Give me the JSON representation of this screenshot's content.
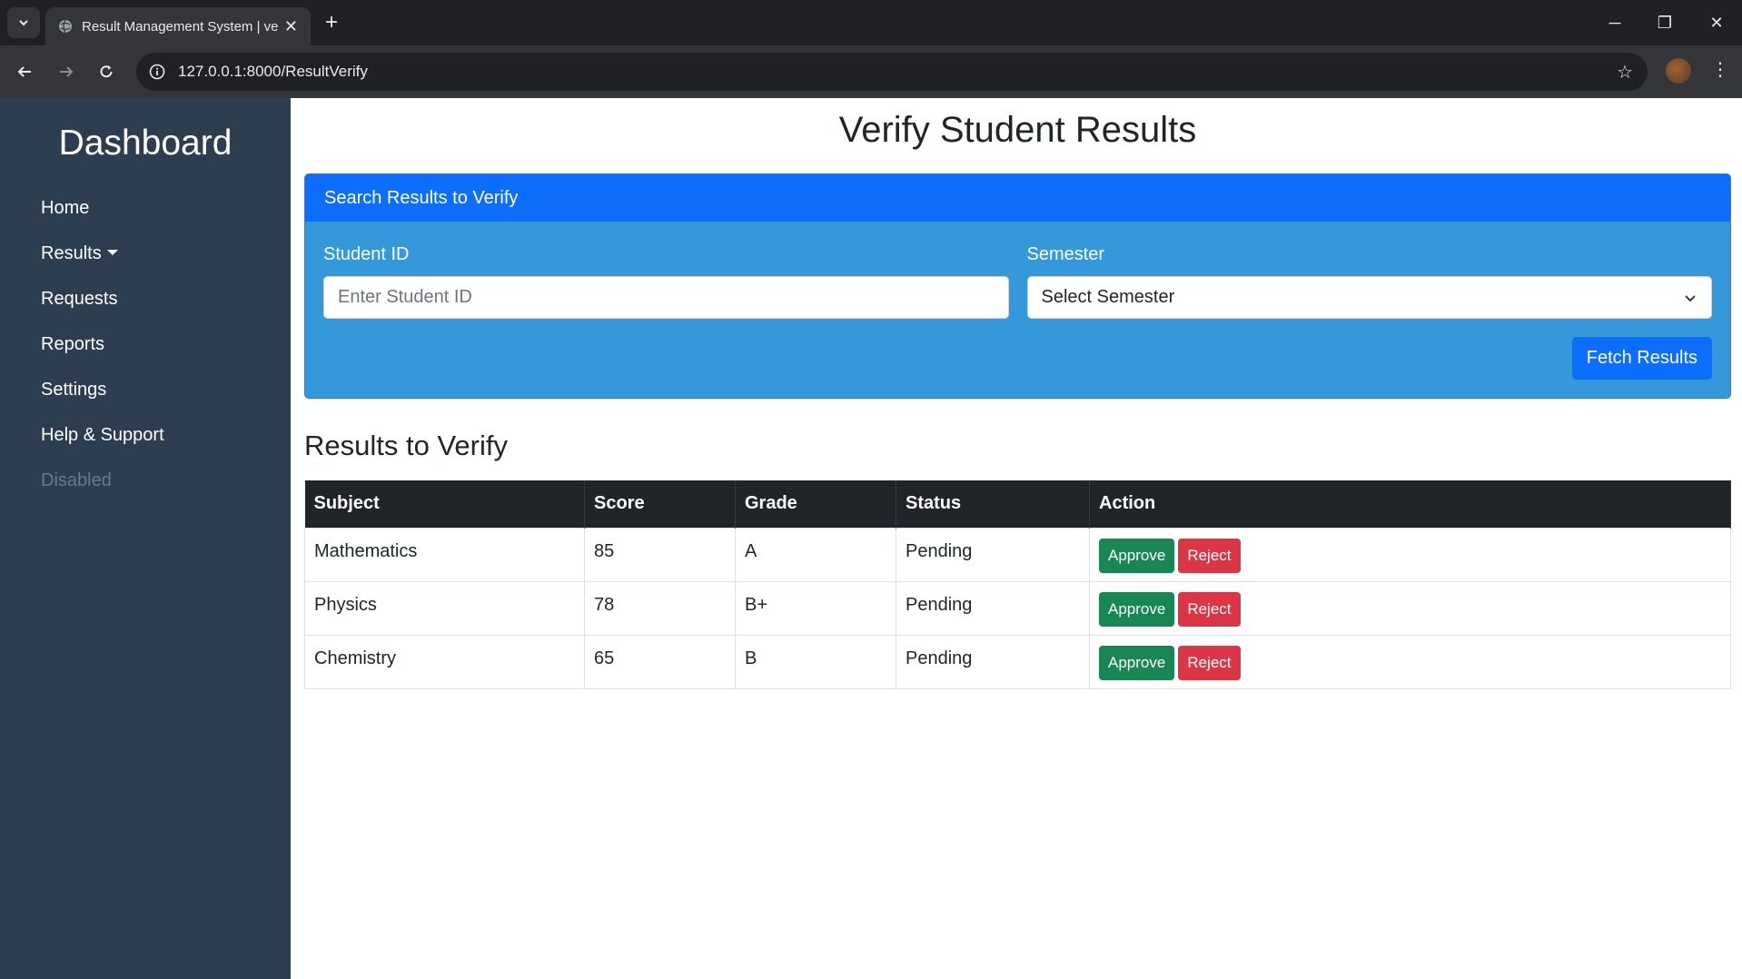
{
  "browser": {
    "tab_title": "Result Management System | ve",
    "url": "127.0.0.1:8000/ResultVerify",
    "new_tab_icon": "plus-icon",
    "minimize": "─",
    "restore": "❐",
    "close": "✕"
  },
  "sidebar": {
    "title": "Dashboard",
    "items": [
      {
        "label": "Home"
      },
      {
        "label": "Results"
      },
      {
        "label": "Requests"
      },
      {
        "label": "Reports"
      },
      {
        "label": "Settings"
      },
      {
        "label": "Help & Support"
      },
      {
        "label": "Disabled"
      }
    ]
  },
  "main": {
    "title": "Verify Student Results",
    "search_card": {
      "header": "Search Results to Verify",
      "student_id_label": "Student ID",
      "student_id_placeholder": "Enter Student ID",
      "student_id_value": "",
      "semester_label": "Semester",
      "semester_selected": "Select Semester",
      "fetch_button": "Fetch Results"
    },
    "results": {
      "title": "Results to Verify",
      "columns": [
        "Subject",
        "Score",
        "Grade",
        "Status",
        "Action"
      ],
      "rows": [
        {
          "subject": "Mathematics",
          "score": "85",
          "grade": "A",
          "status": "Pending"
        },
        {
          "subject": "Physics",
          "score": "78",
          "grade": "B+",
          "status": "Pending"
        },
        {
          "subject": "Chemistry",
          "score": "65",
          "grade": "B",
          "status": "Pending"
        }
      ],
      "approve_label": "Approve",
      "reject_label": "Reject"
    }
  },
  "colors": {
    "sidebar_bg": "#2c3e50",
    "primary": "#0d6efd",
    "card_body": "#3498db",
    "approve": "#198754",
    "reject": "#dc3545",
    "table_header": "#212529"
  }
}
